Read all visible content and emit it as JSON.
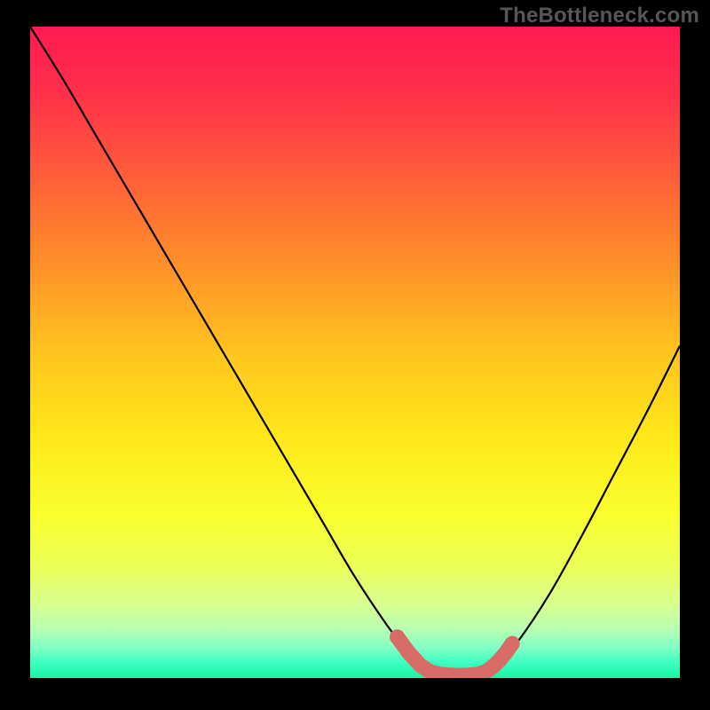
{
  "watermark": "TheBottleneck.com",
  "colors": {
    "gradient_stops": [
      {
        "offset": 0.0,
        "color": "#ff1a52"
      },
      {
        "offset": 0.1,
        "color": "#ff2f4b"
      },
      {
        "offset": 0.22,
        "color": "#ff5a3a"
      },
      {
        "offset": 0.35,
        "color": "#ff8a2b"
      },
      {
        "offset": 0.5,
        "color": "#ffc41f"
      },
      {
        "offset": 0.63,
        "color": "#ffe81a"
      },
      {
        "offset": 0.75,
        "color": "#f9ff2d"
      },
      {
        "offset": 0.83,
        "color": "#ecff5a"
      },
      {
        "offset": 0.885,
        "color": "#d8ff8e"
      },
      {
        "offset": 0.925,
        "color": "#b8ffb3"
      },
      {
        "offset": 0.955,
        "color": "#7effc5"
      },
      {
        "offset": 0.976,
        "color": "#3effc2"
      },
      {
        "offset": 1.0,
        "color": "#19f3a2"
      }
    ],
    "curve": "#000000",
    "marker_fill": "#d96b66",
    "marker_stroke": "#d96b66"
  },
  "chart_data": {
    "type": "line",
    "title": "",
    "xlabel": "",
    "ylabel": "",
    "xlim": [
      0,
      100
    ],
    "ylim": [
      0,
      100
    ],
    "series": [
      {
        "name": "bottleneck-curve",
        "x": [
          0,
          5,
          10,
          15,
          20,
          25,
          30,
          35,
          40,
          45,
          50,
          55,
          58,
          60,
          62,
          64,
          66,
          68,
          70,
          72,
          75,
          80,
          85,
          90,
          95,
          100
        ],
        "y": [
          100,
          92,
          83.5,
          75,
          66.5,
          58,
          49.5,
          41,
          32.5,
          24,
          15.5,
          8,
          4.2,
          2.2,
          1.0,
          0.5,
          0.4,
          0.5,
          1.0,
          2.2,
          5.5,
          13,
          22,
          31.5,
          41,
          51
        ]
      }
    ],
    "markers": {
      "name": "highlight-band",
      "points": [
        {
          "x": 56.5,
          "y": 6.3
        },
        {
          "x": 58.2,
          "y": 4.0
        },
        {
          "x": 60.0,
          "y": 2.0
        },
        {
          "x": 61.5,
          "y": 1.0
        },
        {
          "x": 63.0,
          "y": 0.6
        },
        {
          "x": 64.5,
          "y": 0.45
        },
        {
          "x": 66.0,
          "y": 0.4
        },
        {
          "x": 67.5,
          "y": 0.45
        },
        {
          "x": 69.0,
          "y": 0.6
        },
        {
          "x": 70.2,
          "y": 1.0
        },
        {
          "x": 71.3,
          "y": 1.8
        },
        {
          "x": 72.3,
          "y": 2.8
        },
        {
          "x": 73.3,
          "y": 4.0
        },
        {
          "x": 74.2,
          "y": 5.3
        }
      ]
    }
  }
}
